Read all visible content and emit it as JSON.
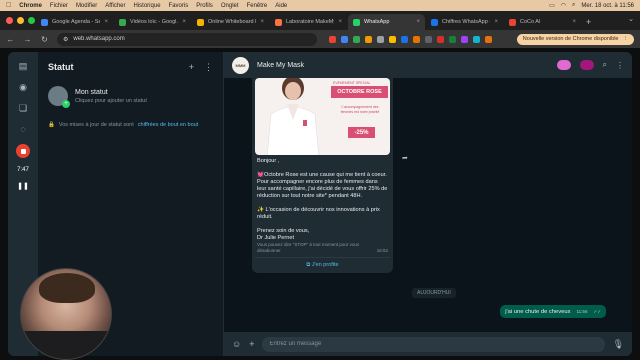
{
  "macos_menu": {
    "app": "Chrome",
    "items": [
      "Fichier",
      "Modifier",
      "Afficher",
      "Historique",
      "Favoris",
      "Profils",
      "Onglet",
      "Fenêtre",
      "Aide"
    ],
    "datetime": "Mer. 18 oct. à 11:56"
  },
  "tabs": [
    {
      "title": "Google Agenda - Se...",
      "color": "#4285f4",
      "active": false
    },
    {
      "title": "Vidéos loïc - Googl...",
      "color": "#34a853",
      "active": false
    },
    {
      "title": "Online Whiteboard l...",
      "color": "#f4b400",
      "active": false
    },
    {
      "title": "Laboratoire MakeMy...",
      "color": "#ff7043",
      "active": false
    },
    {
      "title": "WhatsApp",
      "color": "#25d366",
      "active": true
    },
    {
      "title": "Chiffres WhatsApp -...",
      "color": "#1a73e8",
      "active": false
    },
    {
      "title": "CoCo AI",
      "color": "#ea4335",
      "active": false
    }
  ],
  "browser": {
    "url": "web.whatsapp.com",
    "update_label": "Nouvelle version de Chrome disponible",
    "extension_colors": [
      "#ea4335",
      "#4285f4",
      "#34a853",
      "#f29900",
      "#9aa0a6",
      "#fbbc04",
      "#1a73e8",
      "#e37400",
      "#5f6368",
      "#d93025",
      "#188038",
      "#a142f4",
      "#12b5cb",
      "#e8710a"
    ]
  },
  "recorder": {
    "timer": "7:47"
  },
  "status_panel": {
    "title": "Statut",
    "my_status_name": "Mon statut",
    "my_status_sub": "Cliquez pour ajouter un statut",
    "encryption_prefix": "Vos mises à jour de statut sont",
    "encryption_link": "chiffrées de bout en bout"
  },
  "chat": {
    "contact_name": "Make My Mask",
    "avatar_text": "MMM",
    "promo": {
      "kicker": "EVENEMENT SPECIAL",
      "banner": "OCTOBRE ROSE",
      "tag": "L'accompagnement des femmes est notre priorité",
      "discount": "-25%"
    },
    "message_paragraphs": [
      "Bonjour ,",
      "💓Octobre Rose est une cause qui me tient à coeur. Pour accompagner encore plus de femmes dans leur santé capillaire, j'ai décidé de vous offrir 25% de réduction sur tout notre site* pendant 48H.",
      "✨ L'occasion de découvrir nos innovations à prix réduit.",
      "Prenez soin de vous,\nDr Julie Pernet"
    ],
    "footer_note": "Vous pouvez dire \"STOP\" à tout moment pour vous désabonner",
    "incoming_time": "16:52",
    "profile_link": "J'en profite",
    "day_separator": "AUJOURD'HUI",
    "outgoing_text": "j'ai une chute de cheveux",
    "outgoing_time": "11:56",
    "input_placeholder": "Entrez un message"
  }
}
